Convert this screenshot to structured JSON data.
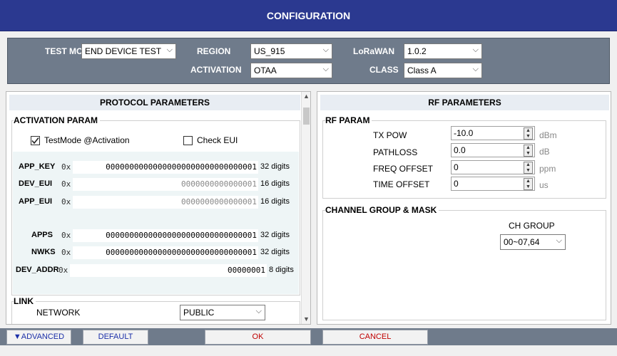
{
  "title": "CONFIGURATION",
  "top": {
    "test_mode_label": "TEST MODE",
    "test_mode_value": "END DEVICE TEST",
    "region_label": "REGION",
    "region_value": "US_915",
    "activation_label": "ACTIVATION",
    "activation_value": "OTAA",
    "lorawan_label": "LoRaWAN",
    "lorawan_value": "1.0.2",
    "class_label": "CLASS",
    "class_value": "Class A"
  },
  "protocol": {
    "header": "PROTOCOL PARAMETERS",
    "activation_legend": "ACTIVATION PARAM",
    "testmode_label": "TestMode @Activation",
    "testmode_checked": true,
    "checkeui_label": "Check EUI",
    "checkeui_checked": false,
    "prefix": "0x",
    "keys": [
      {
        "name": "APP_KEY",
        "value": "00000000000000000000000000000001",
        "digits": "32 digits"
      },
      {
        "name": "DEV_EUI",
        "value": "0000000000000001",
        "digits": "16 digits"
      },
      {
        "name": "APP_EUI",
        "value": "0000000000000001",
        "digits": "16 digits"
      },
      {
        "name": "APPS",
        "value": "00000000000000000000000000000001",
        "digits": "32 digits"
      },
      {
        "name": "NWKS",
        "value": "00000000000000000000000000000001",
        "digits": "32 digits"
      },
      {
        "name": "DEV_ADDR",
        "value": "00000001",
        "digits": "8 digits"
      }
    ],
    "link_legend": "LINK",
    "network_label": "NETWORK",
    "network_value": "PUBLIC"
  },
  "rf": {
    "header": "RF PARAMETERS",
    "param_legend": "RF PARAM",
    "rows": [
      {
        "label": "TX POW",
        "value": "-10.0",
        "unit": "dBm"
      },
      {
        "label": "PATHLOSS",
        "value": "0.0",
        "unit": "dB"
      },
      {
        "label": "FREQ OFFSET",
        "value": "0",
        "unit": "ppm"
      },
      {
        "label": "TIME OFFSET",
        "value": "0",
        "unit": "us"
      }
    ],
    "channel_legend": "CHANNEL GROUP & MASK",
    "ch_group_label": "CH GROUP",
    "ch_group_value": "00~07,64"
  },
  "buttons": {
    "advanced": "▼ADVANCED",
    "default": "DEFAULT",
    "ok": "OK",
    "cancel": "CANCEL"
  },
  "colors": {
    "title_bg": "#2b3990",
    "panel_bg": "#6f7b8b",
    "ok_text": "#c00000",
    "adv_text": "#1a2ea8"
  }
}
